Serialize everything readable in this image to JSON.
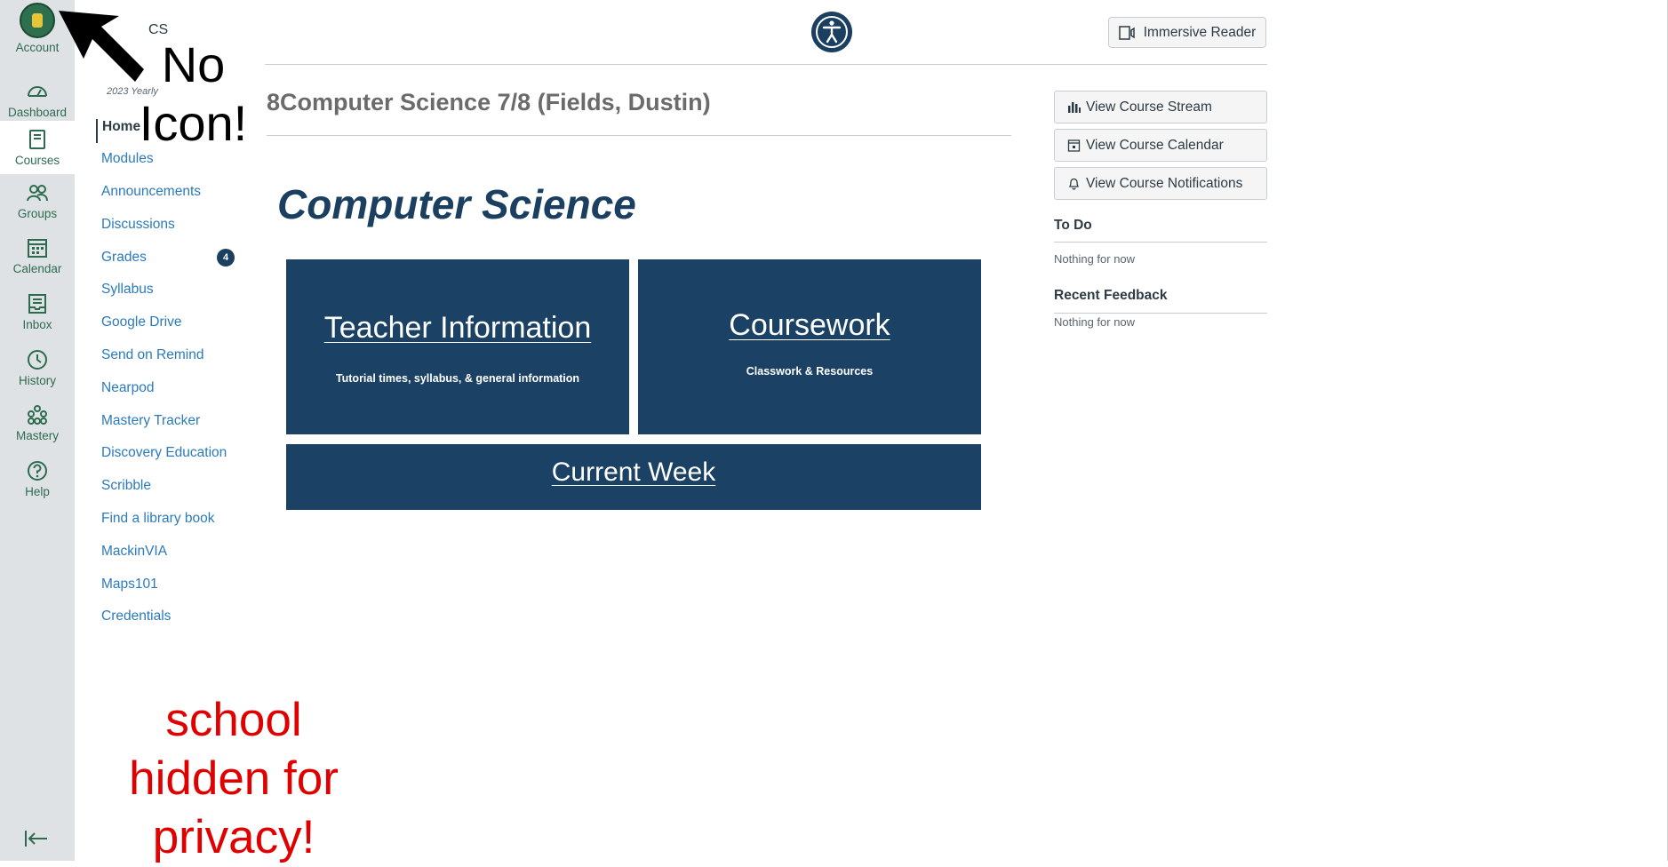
{
  "global_nav": {
    "items": [
      {
        "label": "Account",
        "icon": "account-avatar-icon"
      },
      {
        "label": "Dashboard",
        "icon": "dashboard-icon"
      },
      {
        "label": "Courses",
        "icon": "courses-icon"
      },
      {
        "label": "Groups",
        "icon": "groups-icon"
      },
      {
        "label": "Calendar",
        "icon": "calendar-icon"
      },
      {
        "label": "Inbox",
        "icon": "inbox-icon"
      },
      {
        "label": "History",
        "icon": "history-icon"
      },
      {
        "label": "Mastery",
        "icon": "mastery-icon"
      },
      {
        "label": "Help",
        "icon": "help-icon"
      }
    ],
    "active": "Courses",
    "accent": "#2d6b4f"
  },
  "course_nav": {
    "code": "CS",
    "term": "2023 Yearly",
    "items": [
      "Home",
      "Modules",
      "Announcements",
      "Discussions",
      "Grades",
      "Syllabus",
      "Google Drive",
      "Send on Remind",
      "Nearpod",
      "Mastery Tracker",
      "Discovery Education",
      "Scribble",
      "Find a library book",
      "MackinVIA",
      "Maps101",
      "Credentials"
    ],
    "active": "Home",
    "grades_badge": "4",
    "link_color": "#2b7abc"
  },
  "annotations": {
    "no_icon": "No Icon!",
    "privacy": "school hidden for privacy!"
  },
  "header": {
    "immersive_reader": "Immersive Reader"
  },
  "main": {
    "course_title": "8Computer Science 7/8 (Fields, Dustin)",
    "heading": "Computer Science",
    "tiles": [
      {
        "title": "Teacher Information",
        "subtitle": "Tutorial times, syllabus, & general information"
      },
      {
        "title": "Coursework",
        "subtitle": "Classwork & Resources"
      },
      {
        "title": "Current Week",
        "subtitle": ""
      }
    ],
    "tile_color": "#1b4264"
  },
  "sidebar": {
    "buttons": [
      "View Course Stream",
      "View Course Calendar",
      "View Course Notifications"
    ],
    "todo_heading": "To Do",
    "todo_empty": "Nothing for now",
    "feedback_heading": "Recent Feedback",
    "feedback_empty": "Nothing for now"
  }
}
